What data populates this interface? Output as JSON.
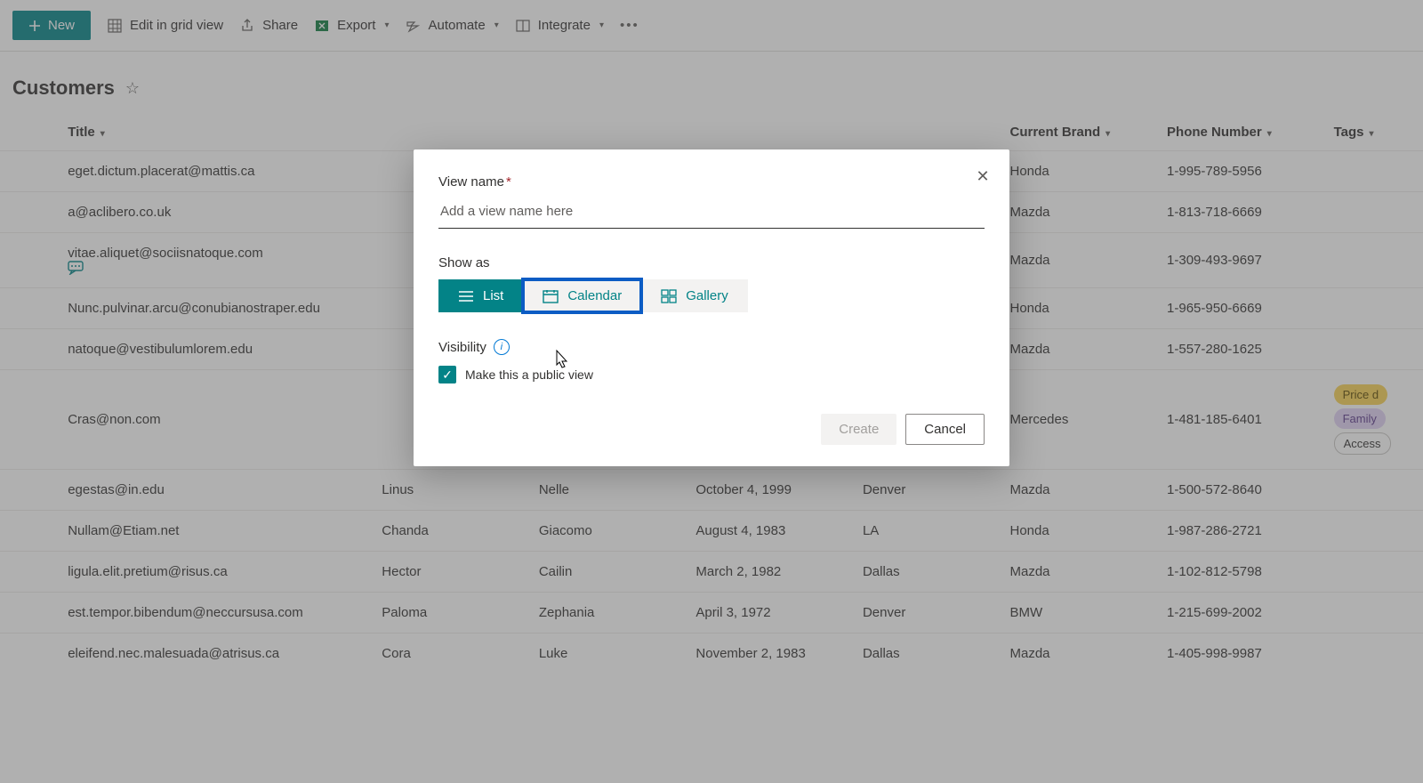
{
  "toolbar": {
    "new_label": "New",
    "edit_grid_label": "Edit in grid view",
    "share_label": "Share",
    "export_label": "Export",
    "automate_label": "Automate",
    "integrate_label": "Integrate"
  },
  "page": {
    "title": "Customers"
  },
  "columns": {
    "title": "Title",
    "first_name": "",
    "last_name": "",
    "dob": "",
    "city": "",
    "brand": "Current Brand",
    "phone": "Phone Number",
    "tags": "Tags"
  },
  "rows": [
    {
      "title": "eget.dictum.placerat@mattis.ca",
      "first": "",
      "last": "",
      "dob": "",
      "city": "",
      "brand": "Honda",
      "phone": "1-995-789-5956",
      "comment": false,
      "tags": []
    },
    {
      "title": "a@aclibero.co.uk",
      "first": "",
      "last": "",
      "dob": "",
      "city": "",
      "brand": "Mazda",
      "phone": "1-813-718-6669",
      "comment": false,
      "tags": []
    },
    {
      "title": "vitae.aliquet@sociisnatoque.com",
      "first": "",
      "last": "",
      "dob": "",
      "city": "",
      "brand": "Mazda",
      "phone": "1-309-493-9697",
      "comment": true,
      "tags": []
    },
    {
      "title": "Nunc.pulvinar.arcu@conubianostraper.edu",
      "first": "",
      "last": "",
      "dob": "",
      "city": "",
      "brand": "Honda",
      "phone": "1-965-950-6669",
      "comment": false,
      "tags": []
    },
    {
      "title": "natoque@vestibulumlorem.edu",
      "first": "",
      "last": "",
      "dob": "",
      "city": "",
      "brand": "Mazda",
      "phone": "1-557-280-1625",
      "comment": false,
      "tags": []
    },
    {
      "title": "Cras@non.com",
      "first": "",
      "last": "",
      "dob": "",
      "city": "",
      "brand": "Mercedes",
      "phone": "1-481-185-6401",
      "comment": false,
      "tags": [
        "Price d",
        "Family",
        "Access"
      ]
    },
    {
      "title": "egestas@in.edu",
      "first": "Linus",
      "last": "Nelle",
      "dob": "October 4, 1999",
      "city": "Denver",
      "brand": "Mazda",
      "phone": "1-500-572-8640",
      "comment": false,
      "tags": []
    },
    {
      "title": "Nullam@Etiam.net",
      "first": "Chanda",
      "last": "Giacomo",
      "dob": "August 4, 1983",
      "city": "LA",
      "brand": "Honda",
      "phone": "1-987-286-2721",
      "comment": false,
      "tags": []
    },
    {
      "title": "ligula.elit.pretium@risus.ca",
      "first": "Hector",
      "last": "Cailin",
      "dob": "March 2, 1982",
      "city": "Dallas",
      "brand": "Mazda",
      "phone": "1-102-812-5798",
      "comment": false,
      "tags": []
    },
    {
      "title": "est.tempor.bibendum@neccursusa.com",
      "first": "Paloma",
      "last": "Zephania",
      "dob": "April 3, 1972",
      "city": "Denver",
      "brand": "BMW",
      "phone": "1-215-699-2002",
      "comment": false,
      "tags": []
    },
    {
      "title": "eleifend.nec.malesuada@atrisus.ca",
      "first": "Cora",
      "last": "Luke",
      "dob": "November 2, 1983",
      "city": "Dallas",
      "brand": "Mazda",
      "phone": "1-405-998-9987",
      "comment": false,
      "tags": []
    }
  ],
  "tag_palette": {
    "Price d": "tag-gold",
    "Family": "tag-purple",
    "Access": "tag-grey"
  },
  "modal": {
    "view_name_label": "View name",
    "view_name_placeholder": "Add a view name here",
    "view_name_value": "",
    "show_as_label": "Show as",
    "opt_list": "List",
    "opt_calendar": "Calendar",
    "opt_gallery": "Gallery",
    "selected_view": "List",
    "focused_view": "Calendar",
    "visibility_label": "Visibility",
    "public_label": "Make this a public view",
    "public_checked": true,
    "create_label": "Create",
    "cancel_label": "Cancel"
  },
  "colors": {
    "accent": "#038387",
    "focus_blue": "#0c5cc4"
  }
}
